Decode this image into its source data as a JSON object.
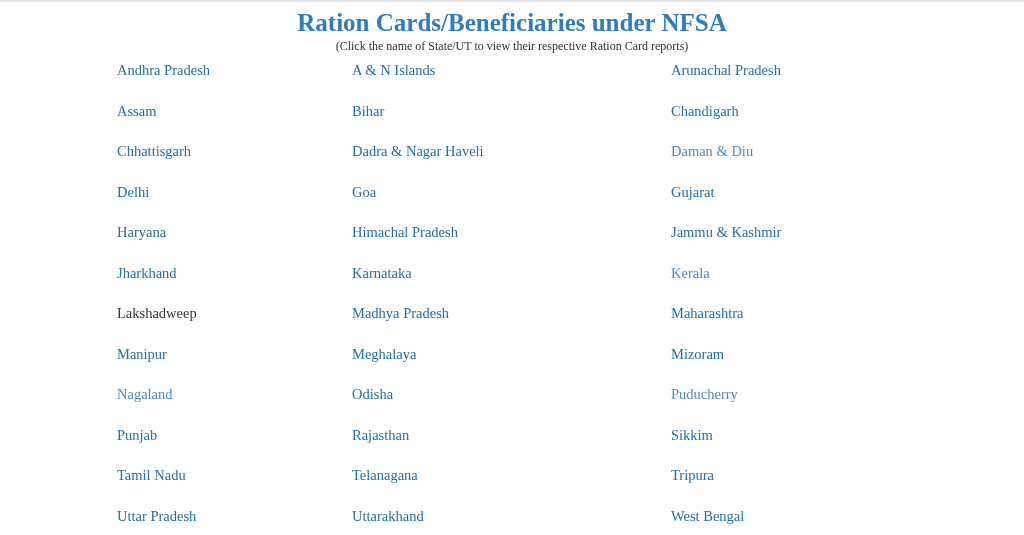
{
  "title": "Ration Cards/Beneficiaries under NFSA",
  "subtitle": "(Click the name of State/UT to view their respective Ration Card reports)",
  "states": [
    {
      "name": "Andhra Pradesh",
      "color": "#1f6ea8"
    },
    {
      "name": "A & N Islands",
      "color": "#1f6ea8"
    },
    {
      "name": "Arunachal Pradesh",
      "color": "#1f6ea8"
    },
    {
      "name": "Assam",
      "color": "#1f6ea8"
    },
    {
      "name": "Bihar",
      "color": "#1f6ea8"
    },
    {
      "name": "Chandigarh",
      "color": "#1f6ea8"
    },
    {
      "name": "Chhattisgarh",
      "color": "#1f6ea8"
    },
    {
      "name": "Dadra & Nagar Haveli",
      "color": "#1f6ea8"
    },
    {
      "name": "Daman & Diu",
      "color": "#4a8cc4"
    },
    {
      "name": "Delhi",
      "color": "#1f6ea8"
    },
    {
      "name": "Goa",
      "color": "#1f6ea8"
    },
    {
      "name": "Gujarat",
      "color": "#1f6ea8"
    },
    {
      "name": "Haryana",
      "color": "#1f6ea8"
    },
    {
      "name": "Himachal Pradesh",
      "color": "#1f6ea8"
    },
    {
      "name": "Jammu & Kashmir",
      "color": "#1f6ea8"
    },
    {
      "name": "Jharkhand",
      "color": "#1f6ea8"
    },
    {
      "name": "Karnataka",
      "color": "#1f6ea8"
    },
    {
      "name": "Kerala",
      "color": "#4a8cc4"
    },
    {
      "name": "Lakshadweep",
      "color": "#333333"
    },
    {
      "name": "Madhya Pradesh",
      "color": "#1f6ea8"
    },
    {
      "name": "Maharashtra",
      "color": "#1f6ea8"
    },
    {
      "name": "Manipur",
      "color": "#1f6ea8"
    },
    {
      "name": "Meghalaya",
      "color": "#1f6ea8"
    },
    {
      "name": "Mizoram",
      "color": "#1f6ea8"
    },
    {
      "name": "Nagaland",
      "color": "#4a8cc4"
    },
    {
      "name": "Odisha",
      "color": "#1f6ea8"
    },
    {
      "name": "Puducherry",
      "color": "#4a8cc4"
    },
    {
      "name": "Punjab",
      "color": "#1f6ea8"
    },
    {
      "name": "Rajasthan",
      "color": "#1f6ea8"
    },
    {
      "name": "Sikkim",
      "color": "#1f6ea8"
    },
    {
      "name": "Tamil Nadu",
      "color": "#1f6ea8"
    },
    {
      "name": "Telanagana",
      "color": "#1f6ea8"
    },
    {
      "name": "Tripura",
      "color": "#1f6ea8"
    },
    {
      "name": "Uttar Pradesh",
      "color": "#1f6ea8"
    },
    {
      "name": "Uttarakhand",
      "color": "#1f6ea8"
    },
    {
      "name": "West Bengal",
      "color": "#1f6ea8"
    }
  ]
}
